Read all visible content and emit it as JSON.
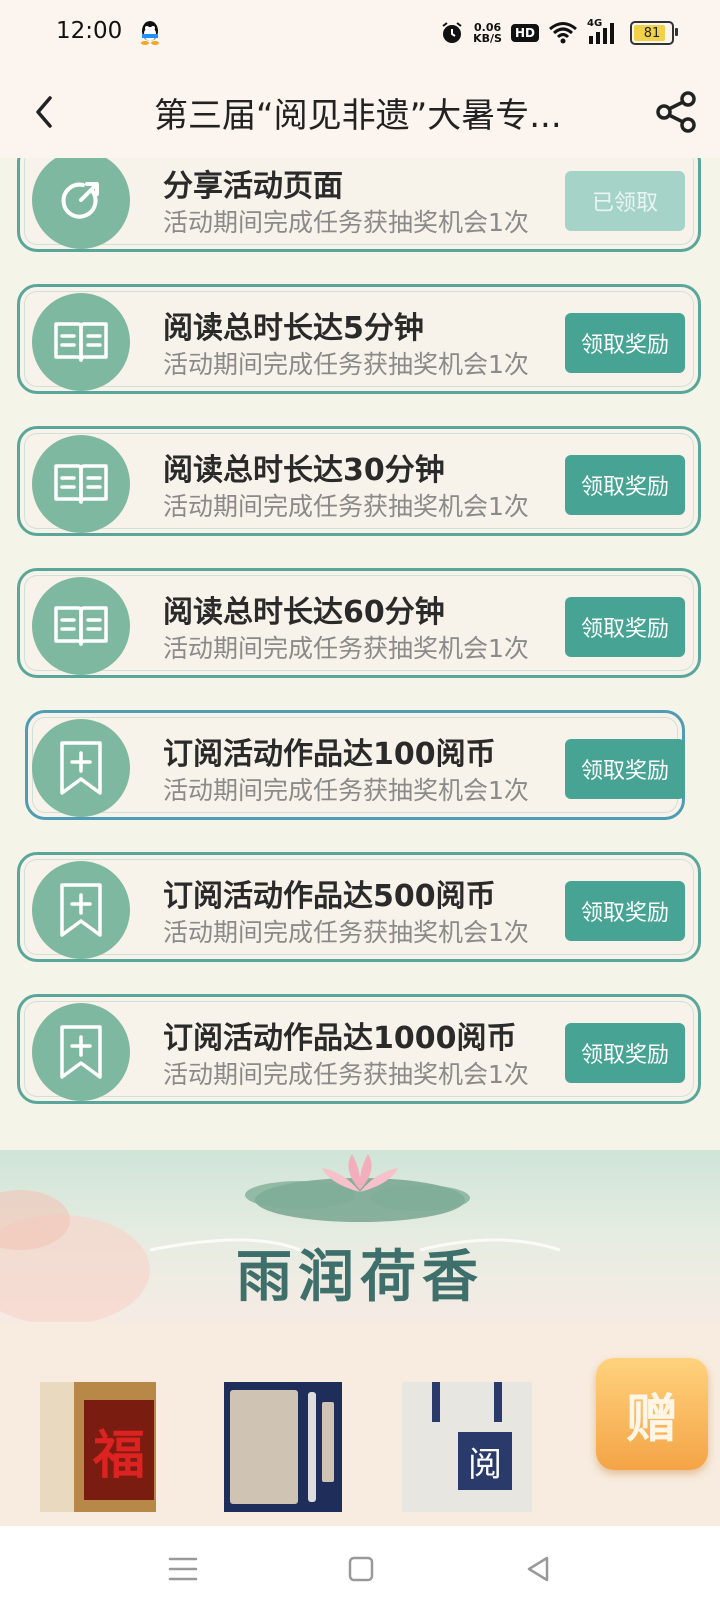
{
  "status": {
    "time": "12:00",
    "net_speed_value": "0.06",
    "net_speed_unit": "KB/S",
    "hd": "HD",
    "signal_label": "4G",
    "battery": "81"
  },
  "header": {
    "title": "第三届“阅见非遗”大暑专..."
  },
  "tasks": [
    {
      "title": "分享活动页面",
      "desc": "活动期间完成任务获抽奖机会1次",
      "button": "已领取",
      "icon": "share-arrow-icon",
      "claimed": true
    },
    {
      "title": "阅读总时长达5分钟",
      "desc": "活动期间完成任务获抽奖机会1次",
      "button": "领取奖励",
      "icon": "book-icon",
      "claimed": false
    },
    {
      "title": "阅读总时长达30分钟",
      "desc": "活动期间完成任务获抽奖机会1次",
      "button": "领取奖励",
      "icon": "book-icon",
      "claimed": false
    },
    {
      "title": "阅读总时长达60分钟",
      "desc": "活动期间完成任务获抽奖机会1次",
      "button": "领取奖励",
      "icon": "book-icon",
      "claimed": false
    },
    {
      "title": "订阅活动作品达100阅币",
      "desc": "活动期间完成任务获抽奖机会1次",
      "button": "领取奖励",
      "icon": "bookmark-plus-icon",
      "claimed": false
    },
    {
      "title": "订阅活动作品达500阅币",
      "desc": "活动期间完成任务获抽奖机会1次",
      "button": "领取奖励",
      "icon": "bookmark-plus-icon",
      "claimed": false
    },
    {
      "title": "订阅活动作品达1000阅币",
      "desc": "活动期间完成任务获抽奖机会1次",
      "button": "领取奖励",
      "icon": "bookmark-plus-icon",
      "claimed": false
    }
  ],
  "banner": {
    "title": "雨润荷香"
  },
  "prizes": {
    "p1_char": "福",
    "p3_char": "阅",
    "gift_label": "赠"
  },
  "colors": {
    "accent": "#47a494",
    "card_border": "#5aa69a",
    "claimed": "#a6d3c8"
  }
}
